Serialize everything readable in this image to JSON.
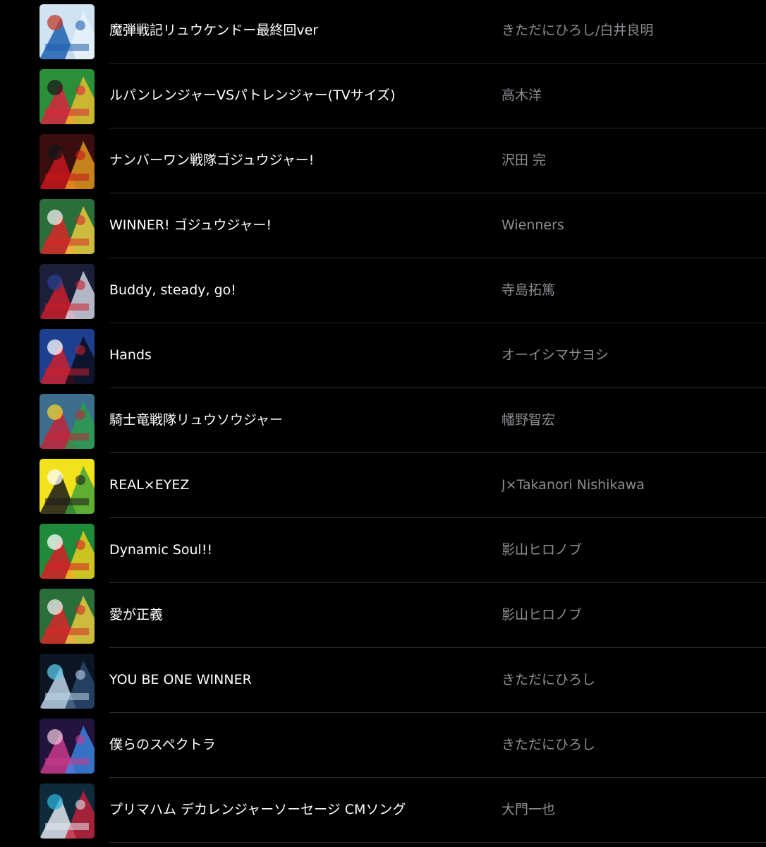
{
  "songs": [
    {
      "title": "魔弾戦記リュウケンドー最終回ver",
      "artist": "きただにひろし/白井良明",
      "art": {
        "bg": "#cfe3f2",
        "c1": "#1f5fb0",
        "c2": "#e9f2fa",
        "c3": "#c33b2c",
        "icon": "album-art-ryukendo-icon"
      }
    },
    {
      "title": "ルパンレンジャーVSパトレンジャー(TVサイズ)",
      "artist": "高木洋",
      "art": {
        "bg": "#2b8f3a",
        "c1": "#d7263d",
        "c2": "#f2c12e",
        "c3": "#1b1b1b",
        "icon": "album-art-lupinranger-icon"
      }
    },
    {
      "title": "ナンバーワン戦隊ゴジュウジャー!",
      "artist": "沢田 完",
      "art": {
        "bg": "#3a0e0e",
        "c1": "#c4161c",
        "c2": "#e8a020",
        "c3": "#14141a",
        "icon": "album-art-gozyuger-music-icon"
      }
    },
    {
      "title": "WINNER! ゴジュウジャー!",
      "artist": "Wienners",
      "art": {
        "bg": "#2a6e3a",
        "c1": "#d62828",
        "c2": "#f4d03f",
        "c3": "#f0f0f0",
        "icon": "album-art-gozyuger-winner-icon"
      }
    },
    {
      "title": "Buddy, steady, go!",
      "artist": "寺島拓篤",
      "art": {
        "bg": "#1b1f3a",
        "c1": "#c81e2c",
        "c2": "#d9dde8",
        "c3": "#2a3f8f",
        "icon": "album-art-ultraman-icon"
      }
    },
    {
      "title": "Hands",
      "artist": "オーイシマサヨシ",
      "art": {
        "bg": "#1c3f8f",
        "c1": "#c8202e",
        "c2": "#0a0a14",
        "c3": "#ffffff",
        "icon": "album-art-hands-icon"
      }
    },
    {
      "title": "騎士竜戦隊リュウソウジャー",
      "artist": "幡野智宏",
      "art": {
        "bg": "#3d6e8e",
        "c1": "#c2263a",
        "c2": "#2b9e4a",
        "c3": "#f2d230",
        "icon": "album-art-ryusoulger-icon"
      }
    },
    {
      "title": "REAL×EYEZ",
      "artist": "J×Takanori Nishikawa",
      "art": {
        "bg": "#f2e21b",
        "c1": "#1a1a1a",
        "c2": "#3aa03a",
        "c3": "#ffffff",
        "icon": "album-art-real-eyez-icon"
      }
    },
    {
      "title": "Dynamic Soul!!",
      "artist": "影山ヒロノブ",
      "art": {
        "bg": "#1f8a3a",
        "c1": "#d61f26",
        "c2": "#f5d21e",
        "c3": "#ffffff",
        "icon": "album-art-dynamic-soul-icon"
      }
    },
    {
      "title": "愛が正義",
      "artist": "影山ヒロノブ",
      "art": {
        "bg": "#2a6e3a",
        "c1": "#d62828",
        "c2": "#f4d03f",
        "c3": "#f0f0f0",
        "icon": "album-art-ai-ga-seigi-icon"
      }
    },
    {
      "title": "YOU BE ONE WINNER",
      "artist": "きただにひろし",
      "art": {
        "bg": "#0b1524",
        "c1": "#bcd4e6",
        "c2": "#2a4a6e",
        "c3": "#5cc8e8",
        "icon": "album-art-you-be-one-winner-icon"
      }
    },
    {
      "title": "僕らのスペクトラ",
      "artist": "きただにひろし",
      "art": {
        "bg": "#23143e",
        "c1": "#c83a8c",
        "c2": "#3a8ae8",
        "c3": "#e8c0d8",
        "icon": "album-art-spectra-icon"
      }
    },
    {
      "title": "プリマハム デカレンジャーソーセージ CMソング",
      "artist": "大門一也",
      "art": {
        "bg": "#0f2a3a",
        "c1": "#e0e6ee",
        "c2": "#c8203a",
        "c3": "#2ab0d8",
        "icon": "album-art-dekaranger-icon"
      }
    }
  ]
}
